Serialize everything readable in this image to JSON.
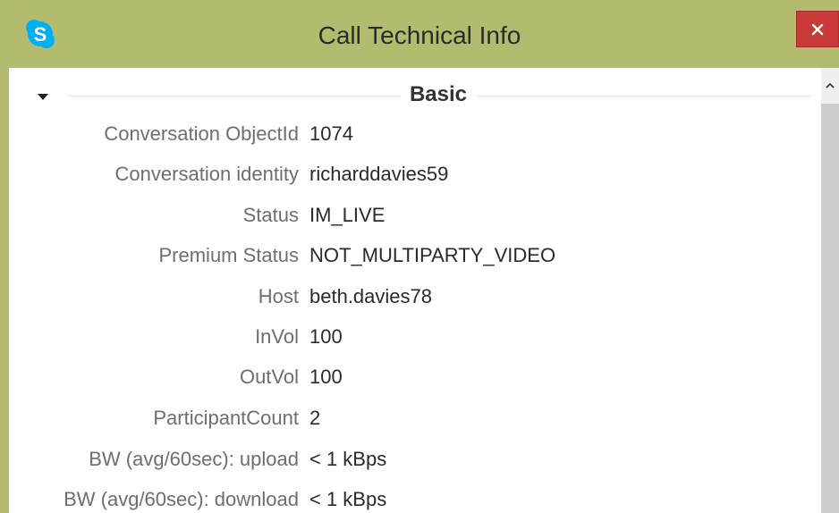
{
  "window": {
    "title": "Call Technical Info",
    "app_icon": "skype-icon",
    "close_icon": "close-icon"
  },
  "section": {
    "title": "Basic",
    "toggle_icon": "collapse-triangle-icon"
  },
  "rows": [
    {
      "label": "Conversation ObjectId",
      "value": "1074"
    },
    {
      "label": "Conversation identity",
      "value": "richarddavies59"
    },
    {
      "label": "Status",
      "value": "IM_LIVE"
    },
    {
      "label": "Premium Status",
      "value": "NOT_MULTIPARTY_VIDEO"
    },
    {
      "label": "Host",
      "value": "beth.davies78"
    },
    {
      "label": "InVol",
      "value": "100"
    },
    {
      "label": "OutVol",
      "value": "100"
    },
    {
      "label": "ParticipantCount",
      "value": "2"
    },
    {
      "label": "BW (avg/60sec): upload",
      "value": "< 1 kBps"
    },
    {
      "label": "BW (avg/60sec): download",
      "value": "< 1 kBps"
    }
  ],
  "colors": {
    "titlebar": "#b3bb6e",
    "close_button": "#c8393a",
    "skype_blue": "#00aff0"
  }
}
